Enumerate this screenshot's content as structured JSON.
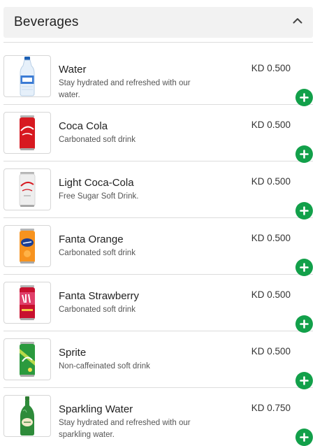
{
  "section": {
    "title": "Beverages",
    "chevron_icon": "chevron-up-icon"
  },
  "currency": "KD",
  "colors": {
    "add_button": "#12a04a",
    "header_bg": "#f2f2f2"
  },
  "items": [
    {
      "name": "Water",
      "description": "Stay hydrated and refreshed with our water.",
      "price": "KD 0.500",
      "image": "water-bottle-icon"
    },
    {
      "name": "Coca Cola",
      "description": "Carbonated soft drink",
      "price": "KD 0.500",
      "image": "coca-cola-can-icon"
    },
    {
      "name": "Light Coca-Cola",
      "description": "Free Sugar Soft Drink.",
      "price": "KD 0.500",
      "image": "coca-cola-light-can-icon"
    },
    {
      "name": "Fanta Orange",
      "description": "Carbonated soft drink",
      "price": "KD 0.500",
      "image": "fanta-orange-can-icon"
    },
    {
      "name": "Fanta Strawberry",
      "description": "Carbonated soft drink",
      "price": "KD 0.500",
      "image": "fanta-strawberry-can-icon"
    },
    {
      "name": "Sprite",
      "description": "Non-caffeinated soft drink",
      "price": "KD 0.500",
      "image": "sprite-can-icon"
    },
    {
      "name": "Sparkling Water",
      "description": "Stay hydrated and refreshed with our sparkling water.",
      "price": "KD 0.750",
      "image": "sparkling-water-bottle-icon"
    }
  ]
}
